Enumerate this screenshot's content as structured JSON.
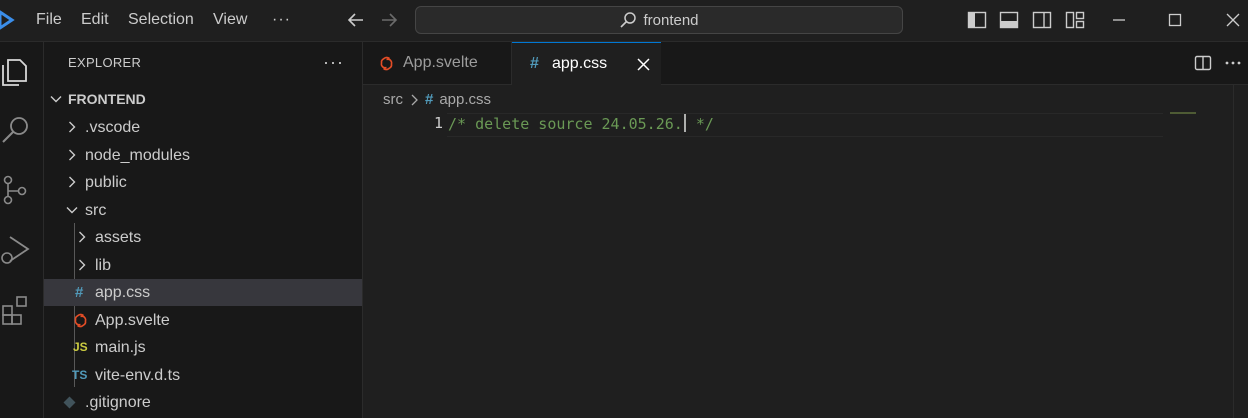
{
  "titlebar": {
    "menu": [
      "File",
      "Edit",
      "Selection",
      "View",
      "···"
    ],
    "search_text": "frontend",
    "icons": [
      "vscode-logo-icon",
      "back-arrow-icon",
      "forward-arrow-icon",
      "search-icon",
      "toggle-primary-sidebar-icon",
      "toggle-panel-icon",
      "toggle-secondary-sidebar-icon",
      "customize-layout-icon",
      "minimize-icon",
      "maximize-icon",
      "close-icon"
    ]
  },
  "activity_bar": {
    "icons": [
      "explorer-icon",
      "search-icon",
      "source-control-icon",
      "run-debug-icon",
      "extensions-icon"
    ]
  },
  "explorer": {
    "title": "EXPLORER",
    "more": "···",
    "root": "FRONTEND",
    "items": [
      {
        "label": ".vscode",
        "type": "folder",
        "expanded": false
      },
      {
        "label": "node_modules",
        "type": "folder",
        "expanded": false
      },
      {
        "label": "public",
        "type": "folder",
        "expanded": false
      },
      {
        "label": "src",
        "type": "folder",
        "expanded": true
      },
      {
        "label": "assets",
        "type": "folder",
        "expanded": false
      },
      {
        "label": "lib",
        "type": "folder",
        "expanded": false
      },
      {
        "label": "app.css",
        "type": "css",
        "icon_text": "#",
        "selected": true
      },
      {
        "label": "App.svelte",
        "type": "svelte"
      },
      {
        "label": "main.js",
        "type": "js",
        "icon_text": "JS"
      },
      {
        "label": "vite-env.d.ts",
        "type": "ts",
        "icon_text": "TS"
      },
      {
        "label": ".gitignore",
        "type": "git"
      }
    ]
  },
  "tabs": [
    {
      "label": "App.svelte",
      "active": false
    },
    {
      "label": "app.css",
      "active": true,
      "icon_text": "#"
    }
  ],
  "editor": {
    "breadcrumb": [
      "src",
      "app.css"
    ],
    "breadcrumb_icon_text": "#",
    "line_number": "1",
    "code_before_cursor": "/* delete source 24.05.26.",
    "code_after_cursor": " */"
  },
  "colors": {
    "accent": "#0078d4",
    "css_icon": "#519aba",
    "svelte_icon": "#e44d26",
    "js_icon": "#cbcb41",
    "ts_icon": "#519aba",
    "comment": "#6a9955"
  }
}
